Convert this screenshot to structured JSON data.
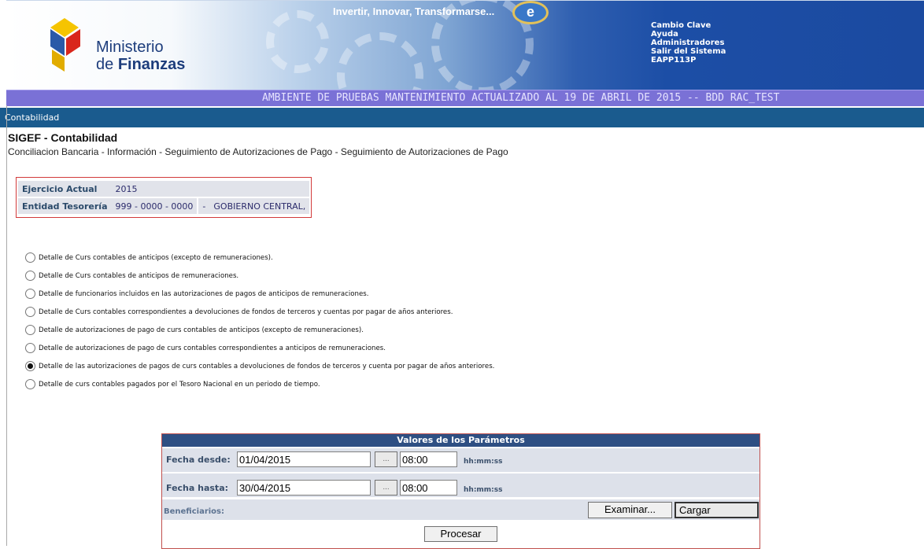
{
  "header": {
    "brand_line1": "Ministerio",
    "brand_line2_prefix": "de ",
    "brand_line2_bold": "Finanzas",
    "slogan": "Invertir, Innovar, Transformarse...",
    "links": [
      "Cambio Clave",
      "Ayuda",
      "Administradores",
      "Salir del Sistema",
      "EAPP113P"
    ],
    "colors": {
      "top_gradient_end": "#1b4aa0",
      "purple_bar": "#7a71d6",
      "nav_bar": "#1a5b8e"
    }
  },
  "banner": "AMBIENTE DE PRUEBAS MANTENIMIENTO ACTUALIZADO AL 19 DE ABRIL DE 2015 -- BDD RAC_TEST",
  "nav": {
    "current": "Contabilidad"
  },
  "page": {
    "title": "SIGEF - Contabilidad",
    "breadcrumb": "Conciliacion Bancaria - Información - Seguimiento de Autorizaciones de Pago - Seguimiento de Autorizaciones de Pago"
  },
  "info": {
    "ejercicio_label": "Ejercicio Actual",
    "ejercicio_value": "2015",
    "entidad_label": "Entidad Tesorería",
    "entidad_code": "999 - 0000 - 0000",
    "entidad_sep": "-",
    "entidad_name": "GOBIERNO CENTRAL,"
  },
  "options": [
    {
      "label": "Detalle de Curs contables de anticipos (excepto de remuneraciones).",
      "selected": false
    },
    {
      "label": "Detalle de Curs contables de anticipos de remuneraciones.",
      "selected": false
    },
    {
      "label": "Detalle de funcionarios incluidos en las autorizaciones de pagos de anticipos de remuneraciones.",
      "selected": false
    },
    {
      "label": "Detalle de Curs contables correspondientes a devoluciones de fondos de terceros y cuentas por pagar de años anteriores.",
      "selected": false
    },
    {
      "label": "Detalle de autorizaciones de pago de curs contables de anticipos (excepto de remuneraciones).",
      "selected": false
    },
    {
      "label": "Detalle de autorizaciones de pago de curs contables correspondientes a anticipos de remuneraciones.",
      "selected": false
    },
    {
      "label": "Detalle de las autorizaciones de pagos de curs contables a devoluciones de fondos de terceros y cuenta por pagar de años anteriores.",
      "selected": true
    },
    {
      "label": "Detalle de curs contables pagados por el Tesoro Nacional en un periodo de tiempo.",
      "selected": false
    }
  ],
  "params": {
    "title": "Valores de los Parámetros",
    "desde_label": "Fecha desde:",
    "desde_date": "01/04/2015",
    "desde_time": "08:00",
    "hasta_label": "Fecha hasta:",
    "hasta_date": "30/04/2015",
    "hasta_time": "08:00",
    "picker_label": "...",
    "time_hint": "hh:mm:ss",
    "beneficiarios_label": "Beneficiarios:",
    "examinar_label": "Examinar...",
    "cargar_label": "Cargar",
    "procesar_label": "Procesar"
  }
}
